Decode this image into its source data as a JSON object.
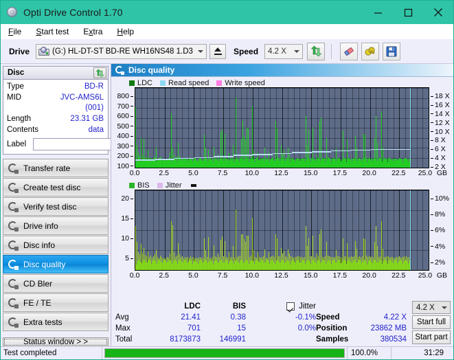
{
  "window": {
    "title": "Opti Drive Control 1.70",
    "icon": "disc-icon",
    "minimize": "minimize",
    "maximize": "maximize",
    "close": "close"
  },
  "menu": {
    "items": [
      {
        "label": "File",
        "accel": "F"
      },
      {
        "label": "Start test",
        "accel": "S"
      },
      {
        "label": "Extra",
        "accel": "x"
      },
      {
        "label": "Help",
        "accel": "H"
      }
    ]
  },
  "toolbar": {
    "drive_label": "Drive",
    "drive_value": "(G:)  HL-DT-ST BD-RE  WH16NS48 1.D3",
    "eject_icon": "eject-icon",
    "speed_label": "Speed",
    "speed_value": "4.2 X",
    "refresh_icon": "refresh-icon",
    "erase_icon": "eraser-icon",
    "settings_icon": "plug-icon",
    "save_icon": "floppy-save-icon"
  },
  "disc_panel": {
    "title": "Disc",
    "refresh_icon": "refresh-icon",
    "rows": [
      {
        "key": "Type",
        "value": "BD-R"
      },
      {
        "key": "MID",
        "value": "JVC-AMS6L (001)"
      },
      {
        "key": "Length",
        "value": "23.31 GB"
      },
      {
        "key": "Contents",
        "value": "data"
      }
    ],
    "label_key": "Label",
    "label_value": "",
    "label_button_icon": "disc-icon"
  },
  "nav": {
    "items": [
      {
        "label": "Transfer rate",
        "icon": "disc-arrow-icon",
        "active": false
      },
      {
        "label": "Create test disc",
        "icon": "disc-write-icon",
        "active": false
      },
      {
        "label": "Verify test disc",
        "icon": "disc-check-icon",
        "active": false
      },
      {
        "label": "Drive info",
        "icon": "drive-info-icon",
        "active": false
      },
      {
        "label": "Disc info",
        "icon": "disc-info-icon",
        "active": false
      },
      {
        "label": "Disc quality",
        "icon": "disc-quality-icon",
        "active": true
      },
      {
        "label": "CD Bler",
        "icon": "disc-bler-icon",
        "active": false
      },
      {
        "label": "FE / TE",
        "icon": "disc-fete-icon",
        "active": false
      },
      {
        "label": "Extra tests",
        "icon": "disc-extra-icon",
        "active": false
      }
    ],
    "status_window_button": "Status window > >"
  },
  "panel": {
    "title": "Disc quality",
    "icon": "disc-quality-icon"
  },
  "stats": {
    "headers": {
      "col1": "LDC",
      "col2": "BIS"
    },
    "rows": [
      {
        "label": "Avg",
        "ldc": "21.41",
        "bis": "0.38",
        "jitter": "-0.1%"
      },
      {
        "label": "Max",
        "ldc": "701",
        "bis": "15",
        "jitter": "0.0%"
      },
      {
        "label": "Total",
        "ldc": "8173873",
        "bis": "146991",
        "jitter": ""
      }
    ],
    "jitter_label": "Jitter",
    "jitter_checked": true,
    "speed_label": "Speed",
    "speed_value": "4.22 X",
    "position_label": "Position",
    "position_value": "23862 MB",
    "samples_label": "Samples",
    "samples_value": "380534",
    "speed_select": "4.2 X",
    "start_full": "Start full",
    "start_part": "Start part"
  },
  "statusbar": {
    "message": "Test completed",
    "progress_percent": "100.0%",
    "progress_value": 100,
    "elapsed": "31:29"
  },
  "colors": {
    "accent": "#2fc4a8",
    "plot_bg": "#5e6c88",
    "ldc_green": "#22d322",
    "bis_green": "#5dd21a",
    "read_speed": "#8fe3f5",
    "write_speed": "#ff7ee0",
    "jitter": "#d9b8e8",
    "value_blue": "#2222cc",
    "progress_green": "#17b317"
  },
  "chart_data": [
    {
      "type": "bar",
      "name": "ldc-chart",
      "title": "",
      "xlabel": "GB",
      "ylabel": "LDC",
      "xlim": [
        0,
        25
      ],
      "ylim": [
        0,
        800
      ],
      "y2lim": [
        0,
        18
      ],
      "y2label": "X",
      "yticks": [
        100,
        200,
        300,
        400,
        500,
        600,
        700,
        800
      ],
      "y2ticks": [
        2,
        4,
        6,
        8,
        10,
        12,
        14,
        16,
        18
      ],
      "xticks": [
        0.0,
        2.5,
        5.0,
        7.5,
        10.0,
        12.5,
        15.0,
        17.5,
        20.0,
        22.5,
        25.0
      ],
      "xtick_labels": [
        "0.0",
        "2.5",
        "5.0",
        "7.5",
        "10.0",
        "12.5",
        "15.0",
        "17.5",
        "20.0",
        "22.5",
        "25.0"
      ],
      "grid": true,
      "legend": [
        {
          "label": "LDC",
          "color": "#127a12"
        },
        {
          "label": "Read speed",
          "color": "#8fd9f2"
        },
        {
          "label": "Write speed",
          "color": "#ff7ee0"
        }
      ],
      "legend_position": "top-left",
      "end_marker_gb": 23.4,
      "baseline": 95,
      "values": [
        605,
        230,
        150,
        120,
        300,
        130,
        290,
        110,
        100,
        180,
        90,
        100,
        85,
        95,
        120,
        200,
        90,
        80,
        110,
        95,
        80,
        70,
        75,
        90,
        80,
        150,
        545,
        200,
        130,
        95,
        110,
        250,
        120,
        90,
        100,
        80,
        95,
        85,
        90,
        75,
        100,
        80,
        90,
        75,
        85,
        70,
        80,
        90,
        75,
        80,
        330,
        200,
        90,
        180,
        80,
        75,
        90,
        210,
        100,
        85,
        130,
        90,
        360,
        380,
        100,
        340,
        90,
        80,
        150,
        95,
        90,
        230,
        80,
        705,
        90,
        95,
        110,
        290,
        470,
        320,
        280,
        400,
        395,
        90,
        110,
        620,
        170,
        90,
        80,
        150,
        85,
        80,
        90,
        95,
        200,
        80,
        75,
        150,
        85,
        100,
        110,
        85,
        470,
        390,
        95,
        100,
        230,
        140,
        180,
        100,
        90,
        200,
        130,
        95,
        90,
        80,
        85,
        90,
        95,
        100,
        90,
        85,
        80,
        90,
        520,
        230,
        380,
        95,
        100,
        400,
        90,
        80,
        130,
        95,
        460,
        505,
        85,
        90,
        100,
        300,
        110,
        100,
        90,
        85,
        80,
        90,
        190,
        95,
        100,
        85,
        80,
        370,
        95,
        100,
        280,
        90,
        85,
        100,
        90,
        95,
        320,
        200,
        90,
        100,
        80,
        95,
        340,
        330,
        110,
        90,
        100,
        85,
        95,
        80,
        300,
        520,
        250,
        90,
        100,
        565,
        200,
        90,
        85,
        100,
        95,
        80,
        85,
        90,
        75,
        80,
        85,
        90,
        95,
        80,
        85,
        90,
        100,
        95,
        80,
        85
      ],
      "read_speed_profile": [
        1.8,
        2.0,
        2.2,
        2.4,
        2.6,
        2.9,
        3.1,
        3.3,
        3.5,
        3.7,
        3.9,
        4.1,
        4.2,
        4.2
      ]
    },
    {
      "type": "bar",
      "name": "bis-chart",
      "title": "",
      "xlabel": "GB",
      "ylabel": "BIS",
      "xlim": [
        0,
        25
      ],
      "ylim": [
        0,
        20
      ],
      "y2lim": [
        0,
        10
      ],
      "y2label": "%",
      "yticks": [
        5,
        10,
        15,
        20
      ],
      "y2ticks": [
        2,
        4,
        6,
        8,
        10
      ],
      "y2tick_labels": [
        "2%",
        "4%",
        "6%",
        "8%",
        "10%"
      ],
      "xticks": [
        0.0,
        2.5,
        5.0,
        7.5,
        10.0,
        12.5,
        15.0,
        17.5,
        20.0,
        22.5,
        25.0
      ],
      "xtick_labels": [
        "0.0",
        "2.5",
        "5.0",
        "7.5",
        "10.0",
        "12.5",
        "15.0",
        "17.5",
        "20.0",
        "22.5",
        "25.0"
      ],
      "grid": true,
      "legend": [
        {
          "label": "BIS",
          "color": "#2bb52b"
        },
        {
          "label": "Jitter",
          "color": "#d9b8e8"
        }
      ],
      "legend_position": "top-left",
      "end_marker_gb": 23.4,
      "baseline": 2.6,
      "values": [
        11.0,
        7.0,
        4.5,
        4.0,
        6.5,
        4.2,
        5.5,
        3.8,
        3.5,
        4.6,
        3.2,
        3.6,
        3.0,
        3.4,
        4.0,
        5.0,
        3.2,
        3.0,
        3.6,
        3.3,
        3.0,
        2.9,
        3.0,
        3.2,
        3.1,
        4.2,
        12.2,
        11.2,
        4.4,
        3.3,
        3.6,
        6.8,
        3.9,
        3.2,
        3.4,
        3.0,
        3.3,
        3.1,
        3.2,
        3.0,
        3.4,
        3.1,
        3.2,
        3.0,
        3.1,
        2.9,
        3.1,
        3.2,
        3.0,
        3.1,
        8.0,
        5.0,
        3.2,
        8.2,
        3.1,
        3.0,
        3.3,
        6.2,
        3.5,
        3.2,
        4.2,
        3.2,
        7.6,
        8.5,
        3.4,
        7.2,
        3.2,
        3.1,
        4.4,
        3.3,
        3.2,
        6.0,
        3.1,
        15.1,
        3.3,
        3.4,
        3.7,
        8.9,
        9.0,
        7.8,
        7.0,
        8.6,
        8.7,
        3.3,
        3.6,
        13.1,
        5.0,
        3.3,
        3.1,
        4.4,
        3.2,
        3.1,
        3.3,
        3.4,
        5.2,
        3.1,
        3.0,
        4.4,
        3.2,
        3.5,
        3.6,
        3.2,
        9.0,
        8.0,
        3.4,
        3.5,
        5.6,
        4.2,
        4.8,
        3.5,
        3.3,
        5.2,
        4.1,
        3.4,
        3.3,
        3.1,
        3.2,
        3.3,
        3.4,
        3.5,
        3.3,
        3.2,
        3.1,
        3.3,
        11.0,
        6.0,
        8.0,
        3.4,
        3.5,
        8.6,
        3.3,
        3.1,
        4.2,
        3.4,
        9.0,
        10.1,
        3.2,
        3.3,
        3.5,
        7.0,
        3.7,
        3.5,
        3.3,
        3.2,
        3.1,
        3.3,
        5.0,
        3.4,
        3.5,
        3.2,
        3.1,
        8.0,
        3.4,
        3.5,
        6.8,
        3.3,
        3.2,
        3.5,
        3.3,
        3.4,
        7.2,
        5.4,
        3.3,
        3.5,
        3.1,
        3.4,
        8.0,
        7.8,
        3.7,
        3.3,
        3.5,
        3.2,
        3.4,
        3.1,
        7.0,
        11.0,
        6.0,
        3.3,
        3.5,
        12.2,
        5.4,
        3.3,
        3.2,
        3.5,
        3.4,
        3.1,
        3.2,
        3.3,
        2.9,
        3.1,
        3.2,
        3.3,
        3.4,
        3.1,
        3.2,
        3.3,
        3.5,
        3.4,
        3.1,
        3.2
      ]
    }
  ]
}
